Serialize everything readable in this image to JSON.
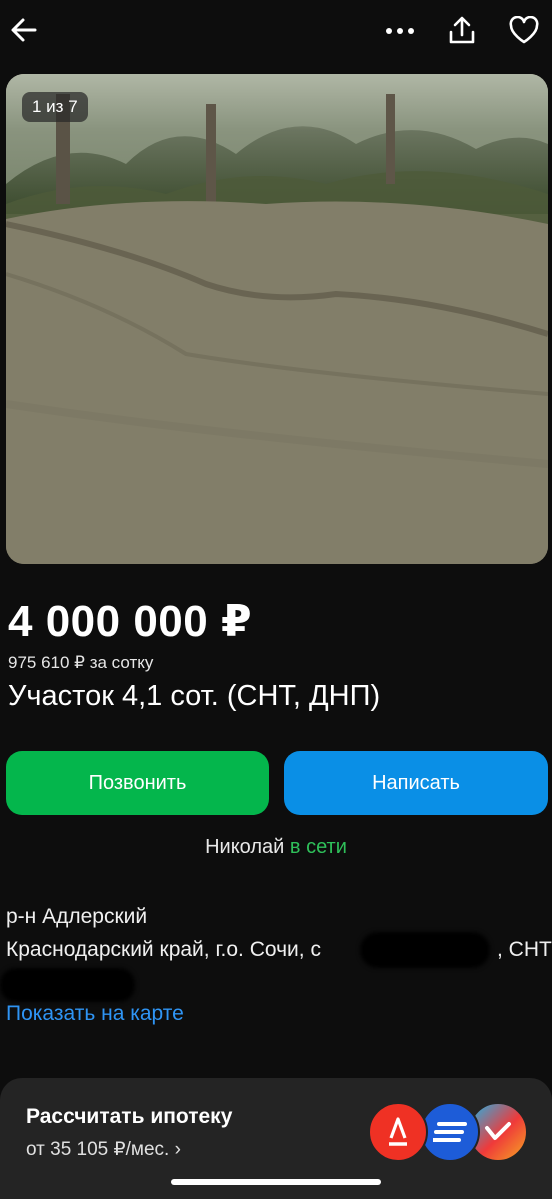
{
  "icons": {
    "back": "arrow-left-icon",
    "more": "more-dots-icon",
    "share": "share-icon",
    "favorite": "heart-icon"
  },
  "gallery": {
    "counter": "1 из 7"
  },
  "listing": {
    "price": "4 000 000 ₽",
    "price_per_unit": "975 610 ₽ за сотку",
    "title": "Участок 4,1 сот. (СНТ, ДНП)"
  },
  "actions": {
    "call_label": "Позвонить",
    "write_label": "Написать"
  },
  "seller": {
    "name": "Николай",
    "status": "в сети"
  },
  "location": {
    "district": "р-н Адлерский",
    "address_start": "Краснодарский край, г.о. Сочи, с",
    "address_end": ", СНТ",
    "map_link": "Показать на карте"
  },
  "mortgage": {
    "title": "Рассчитать ипотеку",
    "subtitle": "от 35 105 ₽/мес. ›"
  },
  "colors": {
    "background": "#0d0d0d",
    "call_button": "#04b64c",
    "write_button": "#0a8fe6",
    "online": "#2fc05a",
    "link": "#2f95f5",
    "banner": "#242424"
  }
}
